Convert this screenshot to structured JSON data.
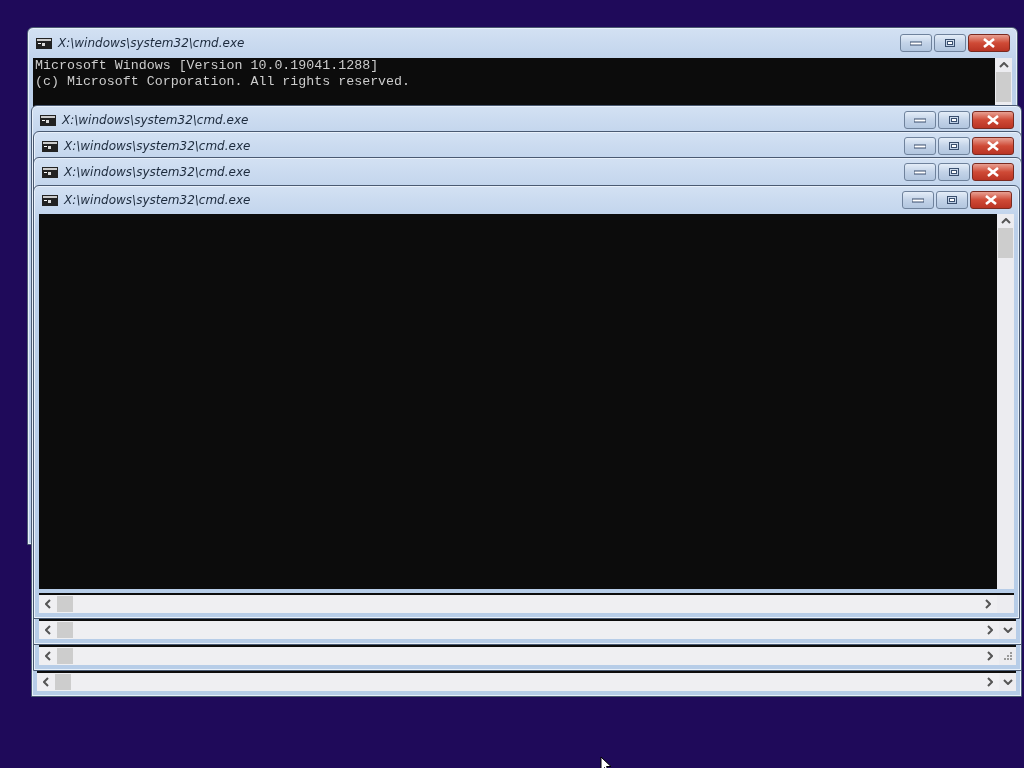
{
  "windows": [
    {
      "title": "X:\\windows\\system32\\cmd.exe",
      "lines": [
        "Microsoft Windows [Version 10.0.19041.1288]",
        "(c) Microsoft Corporation. All rights reserved."
      ]
    },
    {
      "title": "X:\\windows\\system32\\cmd.exe"
    },
    {
      "title": "X:\\windows\\system32\\cmd.exe"
    },
    {
      "title": "X:\\windows\\system32\\cmd.exe"
    },
    {
      "title": "X:\\windows\\system32\\cmd.exe"
    }
  ]
}
